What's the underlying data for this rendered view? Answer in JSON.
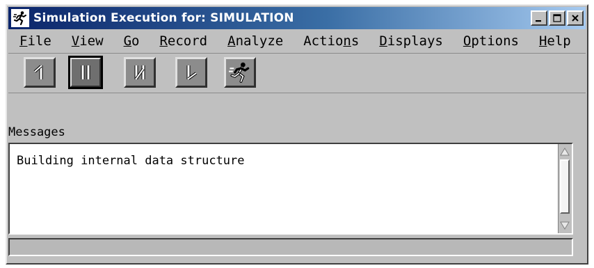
{
  "window": {
    "title": "Simulation Execution for: SIMULATION",
    "icon": "running-man-icon",
    "controls": [
      "minimize-icon",
      "maximize-icon",
      "close-icon"
    ]
  },
  "menu": {
    "items": [
      {
        "label": "File",
        "mnemonic_index": 0
      },
      {
        "label": "View",
        "mnemonic_index": 0
      },
      {
        "label": "Go",
        "mnemonic_index": 0
      },
      {
        "label": "Record",
        "mnemonic_index": 0
      },
      {
        "label": "Analyze",
        "mnemonic_index": 0
      },
      {
        "label": "Actions",
        "mnemonic_index": 5
      },
      {
        "label": "Displays",
        "mnemonic_index": 0
      },
      {
        "label": "Options",
        "mnemonic_index": 0
      },
      {
        "label": "Help",
        "mnemonic_index": 0
      }
    ]
  },
  "toolbar": {
    "buttons": [
      {
        "icon": "step-back-icon",
        "pressed": false
      },
      {
        "icon": "pause-icon",
        "pressed": true
      },
      {
        "icon": "step-icon",
        "pressed": false
      },
      {
        "icon": "step-forward-icon",
        "pressed": false
      },
      {
        "icon": "run-icon",
        "pressed": false
      }
    ]
  },
  "messages": {
    "label": "Messages",
    "text": "Building internal data structure"
  },
  "status": {
    "text": ""
  },
  "colors": {
    "face": "#c0c0c0",
    "titlebar_start": "#0a246a",
    "titlebar_end": "#a6caf0",
    "button_face": "#8c8c8c"
  }
}
